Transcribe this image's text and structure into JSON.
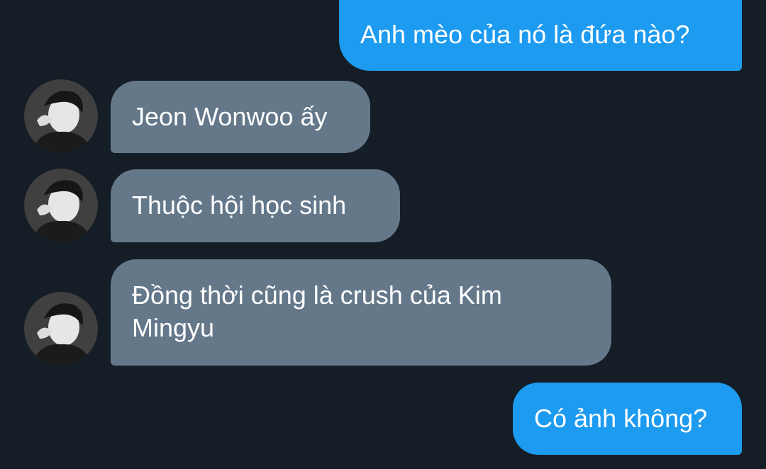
{
  "messages": [
    {
      "direction": "outgoing",
      "text": "Anh mèo của nó là đứa nào?"
    },
    {
      "direction": "incoming",
      "text": "Jeon Wonwoo ấy"
    },
    {
      "direction": "incoming",
      "text": "Thuộc hội học sinh"
    },
    {
      "direction": "incoming",
      "text": "Đồng thời cũng là crush của Kim Mingyu"
    },
    {
      "direction": "outgoing",
      "text": "Có ảnh không?"
    }
  ],
  "colors": {
    "background": "#151d27",
    "outgoing_bubble": "#1d9bf0",
    "incoming_bubble": "#64788a",
    "text": "#ffffff"
  },
  "icons": {
    "avatar": "contact-avatar-photo"
  }
}
